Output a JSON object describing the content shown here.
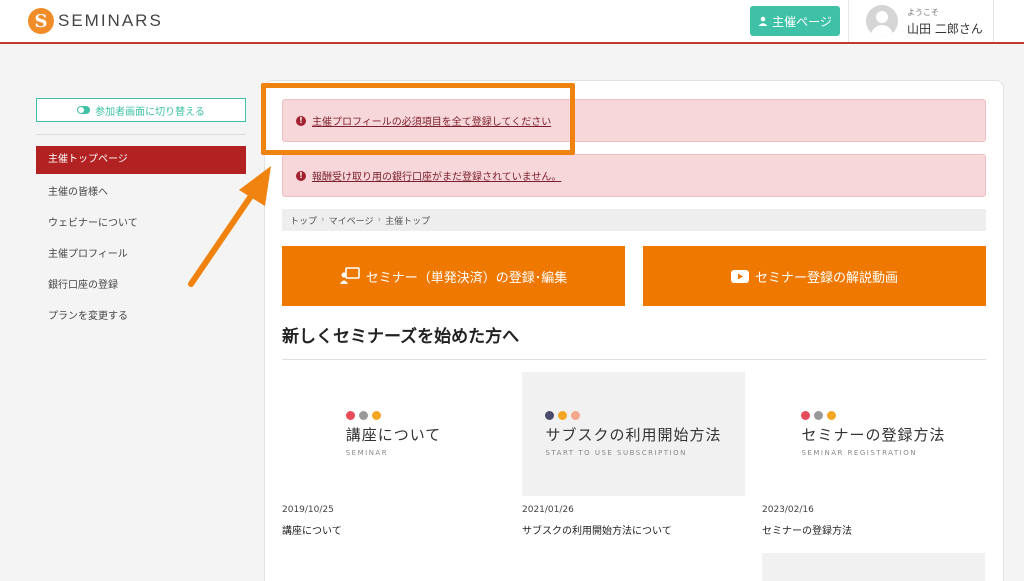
{
  "header": {
    "logo_letter": "S",
    "logo_text": "SEMINARS",
    "host_page_label": "主催ページ",
    "welcome": "ようこそ",
    "user_name": "山田 二郎さん"
  },
  "sidebar": {
    "switch_label": "参加者画面に切り替える",
    "items": [
      {
        "label": "主催トップページ"
      },
      {
        "label": "主催の皆様へ"
      },
      {
        "label": "ウェビナーについて"
      },
      {
        "label": "主催プロフィール"
      },
      {
        "label": "銀行口座の登録"
      },
      {
        "label": "プランを変更する"
      }
    ]
  },
  "alerts": [
    {
      "text": "主催プロフィールの必須項目を全て登録してください"
    },
    {
      "text": "報酬受け取り用の銀行口座がまだ登録されていません。"
    }
  ],
  "breadcrumb": [
    "トップ",
    "マイページ",
    "主催トップ"
  ],
  "buttons": {
    "register_label": "セミナー（単発決済）の登録･編集",
    "video_label": "セミナー登録の解説動画"
  },
  "section_title": "新しくセミナーズを始めた方へ",
  "cards": [
    {
      "image_title": "講座について",
      "image_sub": "SEMINAR",
      "date": "2019/10/25",
      "name": "講座について",
      "dot_colors": [
        "#e74c5a",
        "#999999",
        "#f5a623"
      ]
    },
    {
      "image_title": "サブスクの利用開始方法",
      "image_sub": "START TO USE SUBSCRIPTION",
      "date": "2021/01/26",
      "name": "サブスクの利用開始方法について",
      "dot_colors": [
        "#4a4a6a",
        "#f5a623",
        "#f3a88c"
      ]
    },
    {
      "image_title": "セミナーの登録方法",
      "image_sub": "SEMINAR REGISTRATION",
      "date": "2023/02/16",
      "name": "セミナーの登録方法",
      "dot_colors": [
        "#e74c5a",
        "#999999",
        "#f5a623"
      ]
    }
  ],
  "colors": {
    "accent_orange": "#ef7800",
    "teal": "#3ec1a6",
    "active_red": "#b22222",
    "alert_bg": "#f8d7da"
  }
}
